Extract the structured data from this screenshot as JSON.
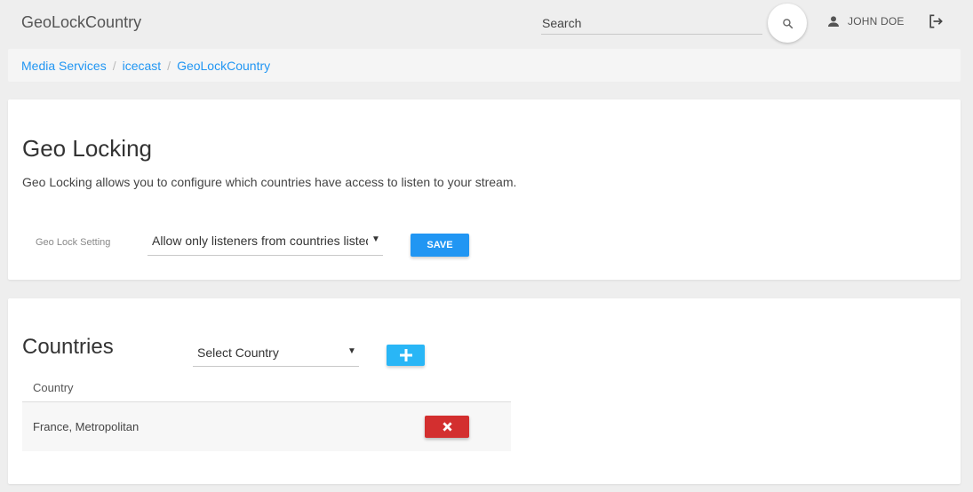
{
  "header": {
    "app_title": "GeoLockCountry",
    "search_placeholder": "Search",
    "search_icon": "search-icon",
    "user_icon": "person-icon",
    "user_name": "JOHN DOE",
    "logout_icon": "logout-icon"
  },
  "breadcrumb": [
    {
      "label": "Media Services"
    },
    {
      "label": "icecast"
    },
    {
      "label": "GeoLockCountry"
    }
  ],
  "geo_locking": {
    "title": "Geo Locking",
    "description": "Geo Locking allows you to configure which countries have access to listen to your stream.",
    "setting_label": "Geo Lock Setting",
    "setting_value": "Allow only listeners from countries listed",
    "save_label": "SAVE"
  },
  "countries": {
    "title": "Countries",
    "select_placeholder": "Select Country",
    "add_icon": "plus-icon",
    "column_header": "Country",
    "rows": [
      {
        "name": "France, Metropolitan",
        "action_icon": "close-icon"
      }
    ]
  },
  "colors": {
    "accent": "#2196f3",
    "add_button": "#29b6f6",
    "delete_button": "#d32f2f"
  }
}
